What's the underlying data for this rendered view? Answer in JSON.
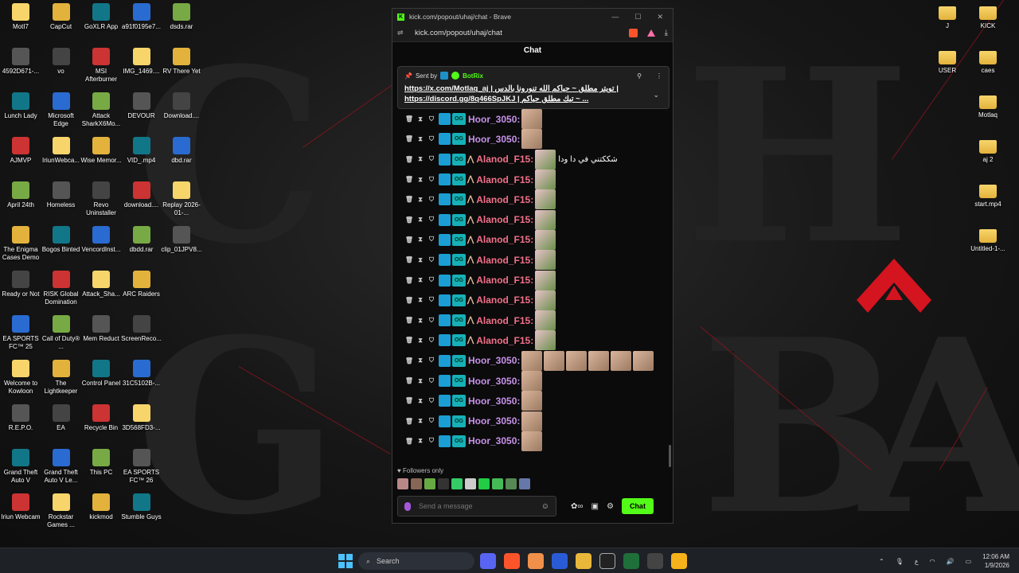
{
  "window": {
    "title": "kick.com/popout/uhaj/chat - Brave",
    "url": "kick.com/popout/uhaj/chat",
    "controls": [
      "—",
      "☐",
      "✕"
    ]
  },
  "chat": {
    "header": "Chat",
    "pinned": {
      "sent_by_label": "Sent by",
      "sender": "BotRix",
      "line1": "https://x.com/Motlaq_aj | تويتر مطلق ~ حياكم الله تنورونا بالدس |",
      "line2": "https://discord.gg/8q466SpJKJ | تيك مطلق حياكم ~ ..."
    },
    "messages": [
      {
        "user": "Hoor_3050:",
        "color": "#c792ea",
        "crown": false,
        "text": "",
        "emotes": 1
      },
      {
        "user": "Hoor_3050:",
        "color": "#c792ea",
        "crown": false,
        "text": "",
        "emotes": 1
      },
      {
        "user": "Alanod_F15:",
        "color": "#f2708a",
        "crown": true,
        "text": "شككتني في دا ودا",
        "emotes": 1
      },
      {
        "user": "Alanod_F15:",
        "color": "#f2708a",
        "crown": true,
        "text": "",
        "emotes": 1
      },
      {
        "user": "Alanod_F15:",
        "color": "#f2708a",
        "crown": true,
        "text": "",
        "emotes": 1
      },
      {
        "user": "Alanod_F15:",
        "color": "#f2708a",
        "crown": true,
        "text": "",
        "emotes": 1
      },
      {
        "user": "Alanod_F15:",
        "color": "#f2708a",
        "crown": true,
        "text": "",
        "emotes": 1
      },
      {
        "user": "Alanod_F15:",
        "color": "#f2708a",
        "crown": true,
        "text": "",
        "emotes": 1
      },
      {
        "user": "Alanod_F15:",
        "color": "#f2708a",
        "crown": true,
        "text": "",
        "emotes": 1
      },
      {
        "user": "Alanod_F15:",
        "color": "#f2708a",
        "crown": true,
        "text": "",
        "emotes": 1
      },
      {
        "user": "Alanod_F15:",
        "color": "#f2708a",
        "crown": true,
        "text": "",
        "emotes": 1
      },
      {
        "user": "Alanod_F15:",
        "color": "#f2708a",
        "crown": true,
        "text": "",
        "emotes": 1
      },
      {
        "user": "Hoor_3050:",
        "color": "#c792ea",
        "crown": false,
        "text": "",
        "emotes": 6
      },
      {
        "user": "Hoor_3050:",
        "color": "#c792ea",
        "crown": false,
        "text": "",
        "emotes": 1
      },
      {
        "user": "Hoor_3050:",
        "color": "#c792ea",
        "crown": false,
        "text": "",
        "emotes": 1
      },
      {
        "user": "Hoor_3050:",
        "color": "#c792ea",
        "crown": false,
        "text": "",
        "emotes": 1
      },
      {
        "user": "Hoor_3050:",
        "color": "#c792ea",
        "crown": false,
        "text": "",
        "emotes": 1
      }
    ],
    "followers_only": "Followers only",
    "input_placeholder": "Send a message",
    "send_button": "Chat"
  },
  "desktop": {
    "left_icons": [
      "MotI7",
      "CapCut",
      "GoXLR App",
      "a91f0195e7...",
      "dsds.rar",
      "4592D671-...",
      "vo",
      "MSI Afterburner",
      "IMG_1469....",
      "RV There Yet",
      "Lunch Lady",
      "Microsoft Edge",
      "Attack SharkX6Mo...",
      "DEVOUR",
      "Download....",
      "AJMVP",
      "IriunWebca...",
      "Wise Memor...",
      "VID_.mp4",
      "dbd.rar",
      "April 24th",
      "Homeless",
      "Revo Uninstaller",
      "download....",
      "Replay 2026-01-...",
      "The Enigma Cases Demo",
      "Bogos Binted",
      "VencordInst...",
      "dbdd.rar",
      "clip_01JPV8...",
      "Ready or Not",
      "RISK Global Domination",
      "Attack_Sha...",
      "ARC Raiders",
      "",
      "EA SPORTS FC™ 25",
      "Call of Duty® ...",
      "Mem Reduct",
      "ScreenReco...",
      "",
      "Welcome to Kowloon",
      "The Lightkeeper",
      "Control Panel",
      "31C5102B-...",
      "",
      "R.E.P.O.",
      "EA",
      "Recycle Bin",
      "3D568FD3-...",
      "",
      "Grand Theft Auto V",
      "Grand Theft Auto V Le...",
      "This PC",
      "EA SPORTS FC™ 26",
      "",
      "Iriun Webcam",
      "Rockstar Games ...",
      "kickmod",
      "Stumble Guys",
      ""
    ],
    "right_icons": [
      {
        "a": "J",
        "b": "KICK"
      },
      {
        "a": "USER",
        "b": "caes"
      },
      {
        "a": "",
        "b": "Motlaq"
      },
      {
        "a": "",
        "b": "aj 2"
      },
      {
        "a": "",
        "b": "start.mp4"
      },
      {
        "a": "",
        "b": "Untitled-1-..."
      }
    ]
  },
  "taskbar": {
    "search": "Search",
    "lang": "ع",
    "time": "12:06 AM",
    "date": "1/9/2026"
  }
}
